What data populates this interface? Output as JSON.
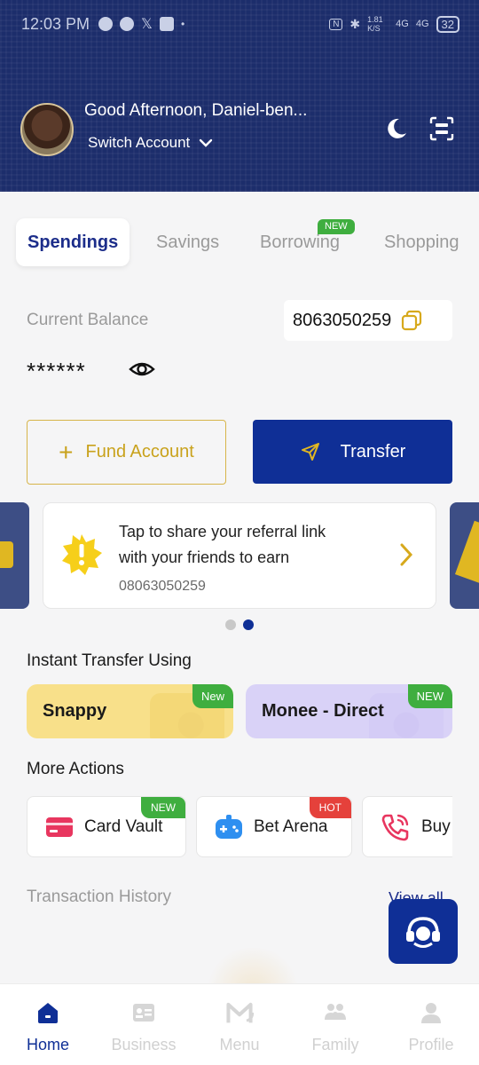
{
  "status_bar": {
    "time": "12:03 PM",
    "speed": "1.81 K/S",
    "net1": "4G",
    "net2": "4G",
    "battery": "32"
  },
  "header": {
    "greeting": "Good Afternoon,  Daniel-ben...",
    "switch_account": "Switch Account"
  },
  "tabs": [
    {
      "label": "Spendings",
      "active": true
    },
    {
      "label": "Savings"
    },
    {
      "label": "Borrowing",
      "badge": "NEW"
    },
    {
      "label": "Shopping"
    }
  ],
  "balance": {
    "label": "Current Balance",
    "account_number": "8063050259",
    "masked": "******"
  },
  "actions": {
    "fund": "Fund Account",
    "transfer": "Transfer"
  },
  "referral": {
    "line1": "Tap to share your referral link",
    "line2": "with your friends to earn",
    "phone": "08063050259"
  },
  "carousel": {
    "count": 2,
    "active": 2
  },
  "instant_transfer": {
    "title": "Instant Transfer Using",
    "items": [
      {
        "label": "Snappy",
        "badge": "New"
      },
      {
        "label": "Monee - Direct",
        "badge": "NEW"
      }
    ]
  },
  "more_actions": {
    "title": "More Actions",
    "items": [
      {
        "label": "Card Vault",
        "badge": "NEW"
      },
      {
        "label": "Bet Arena",
        "badge": "HOT"
      },
      {
        "label": "Buy"
      }
    ]
  },
  "transactions": {
    "title": "Transaction History",
    "view_all": "View all"
  },
  "bottom_nav": [
    {
      "label": "Home",
      "active": true
    },
    {
      "label": "Business"
    },
    {
      "label": "Menu"
    },
    {
      "label": "Family"
    },
    {
      "label": "Profile"
    }
  ],
  "colors": {
    "brand_blue": "#0f2f96",
    "header_navy": "#1c2d6b",
    "gold": "#c9a21c",
    "badge_green": "#3fae3f",
    "badge_red": "#e5413b"
  }
}
